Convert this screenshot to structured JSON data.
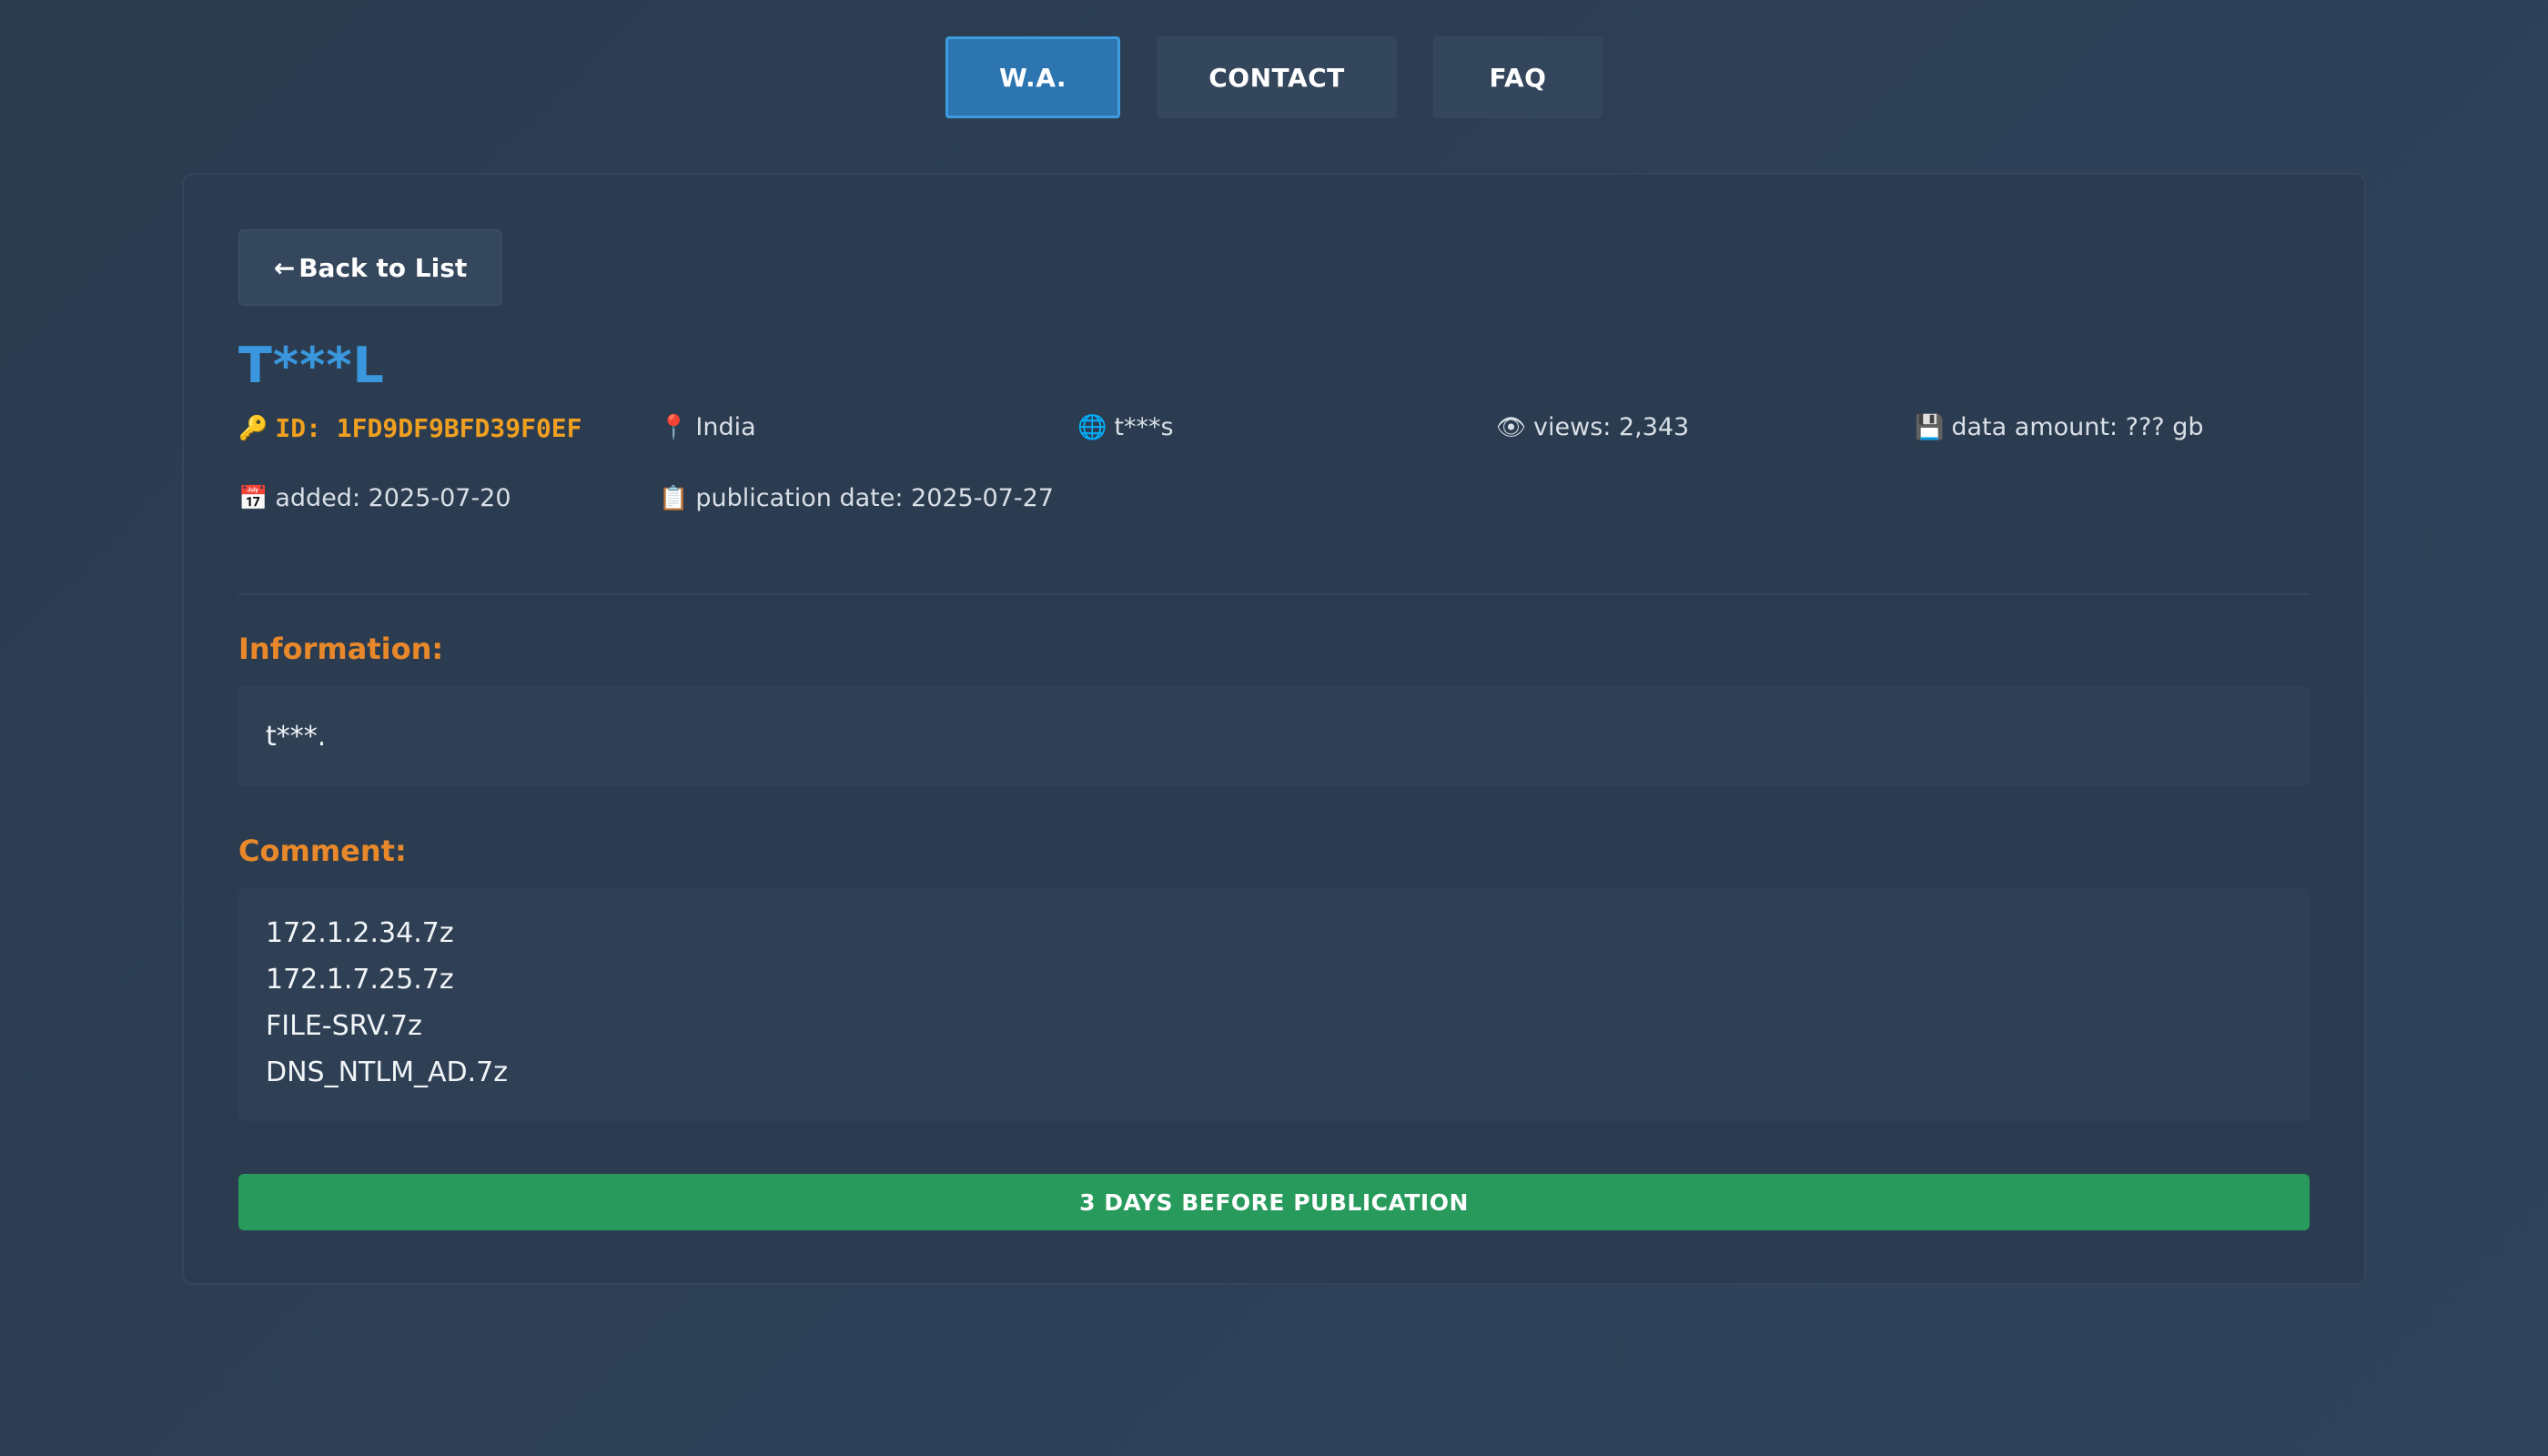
{
  "nav": {
    "items": [
      {
        "label": "W.A.",
        "active": true
      },
      {
        "label": "CONTACT",
        "active": false
      },
      {
        "label": "FAQ",
        "active": false
      }
    ]
  },
  "detail": {
    "back_label": "Back to List",
    "back_arrow": "←",
    "title": "T***L",
    "meta": {
      "id_icon": "🔑",
      "id": "ID: 1FD9DF9BFD39F0EF",
      "location_icon": "📍",
      "location": "India",
      "site_icon": "🌐",
      "site": "t***s",
      "views_icon": "👁",
      "views": "views: 2,343",
      "data_icon": "💾",
      "data_amount": "data amount: ??? gb",
      "added_icon": "📅",
      "added": "added: 2025-07-20",
      "publication_icon": "📋",
      "publication": "publication date: 2025-07-27"
    },
    "information_label": "Information:",
    "information_text": "t***.",
    "comment_label": "Comment:",
    "comment_lines": [
      "172.1.2.34.7z",
      "172.1.7.25.7z",
      "FILE-SRV.7z",
      "DNS_NTLM_AD.7z"
    ],
    "status": "3 DAYS BEFORE PUBLICATION"
  },
  "colors": {
    "accent_blue": "#3a97de",
    "accent_orange": "#e8882a",
    "id_yellow": "#f0a020",
    "status_green": "#279a5c"
  }
}
